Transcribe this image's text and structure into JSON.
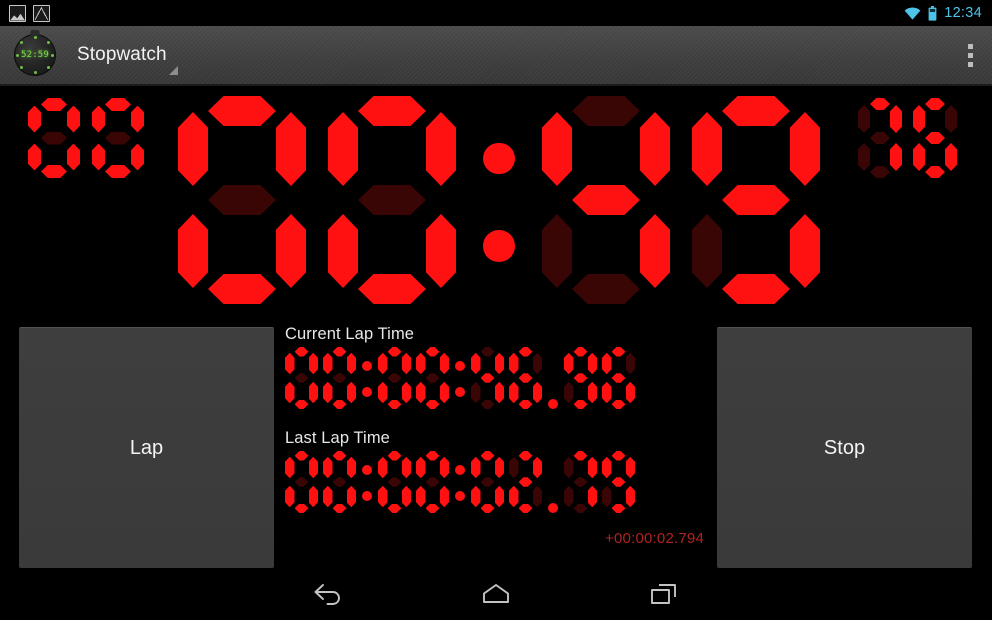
{
  "status_bar": {
    "notifications": [
      "screenshot-icon",
      "gmail-icon"
    ],
    "wifi_icon": "wifi-icon",
    "battery_icon": "battery-icon",
    "clock": "12:34",
    "clock_color": "#4dc3e8"
  },
  "action_bar": {
    "app_icon": "stopwatch-app-icon",
    "app_icon_lcd": "52:59",
    "title": "Stopwatch",
    "dropdown_caret": "caret-icon",
    "overflow_menu": "overflow-menu-icon"
  },
  "main_timer": {
    "hours": "00",
    "minutes": "00",
    "seconds": "49",
    "hundredths": "76",
    "full_value": "00:00:49.76",
    "segment_on_color": "#ff1111",
    "segment_off_color": "#3a0505"
  },
  "buttons": {
    "lap_label": "Lap",
    "stop_label": "Stop"
  },
  "current_lap": {
    "label": "Current Lap Time",
    "value": "00:00:46.96",
    "digits": [
      "0",
      "0",
      ":",
      "0",
      "0",
      ":",
      "4",
      "6",
      ".",
      "9",
      "6"
    ]
  },
  "last_lap": {
    "label": "Last Lap Time",
    "value": "00:00:02.79",
    "digits": [
      "0",
      "0",
      ":",
      "0",
      "0",
      ":",
      "0",
      "2",
      ".",
      "7",
      "9"
    ],
    "delta": "+00:00:02.794",
    "delta_color": "#b22222"
  },
  "nav_bar": {
    "back": "back-icon",
    "home": "home-icon",
    "recent": "recent-apps-icon"
  }
}
